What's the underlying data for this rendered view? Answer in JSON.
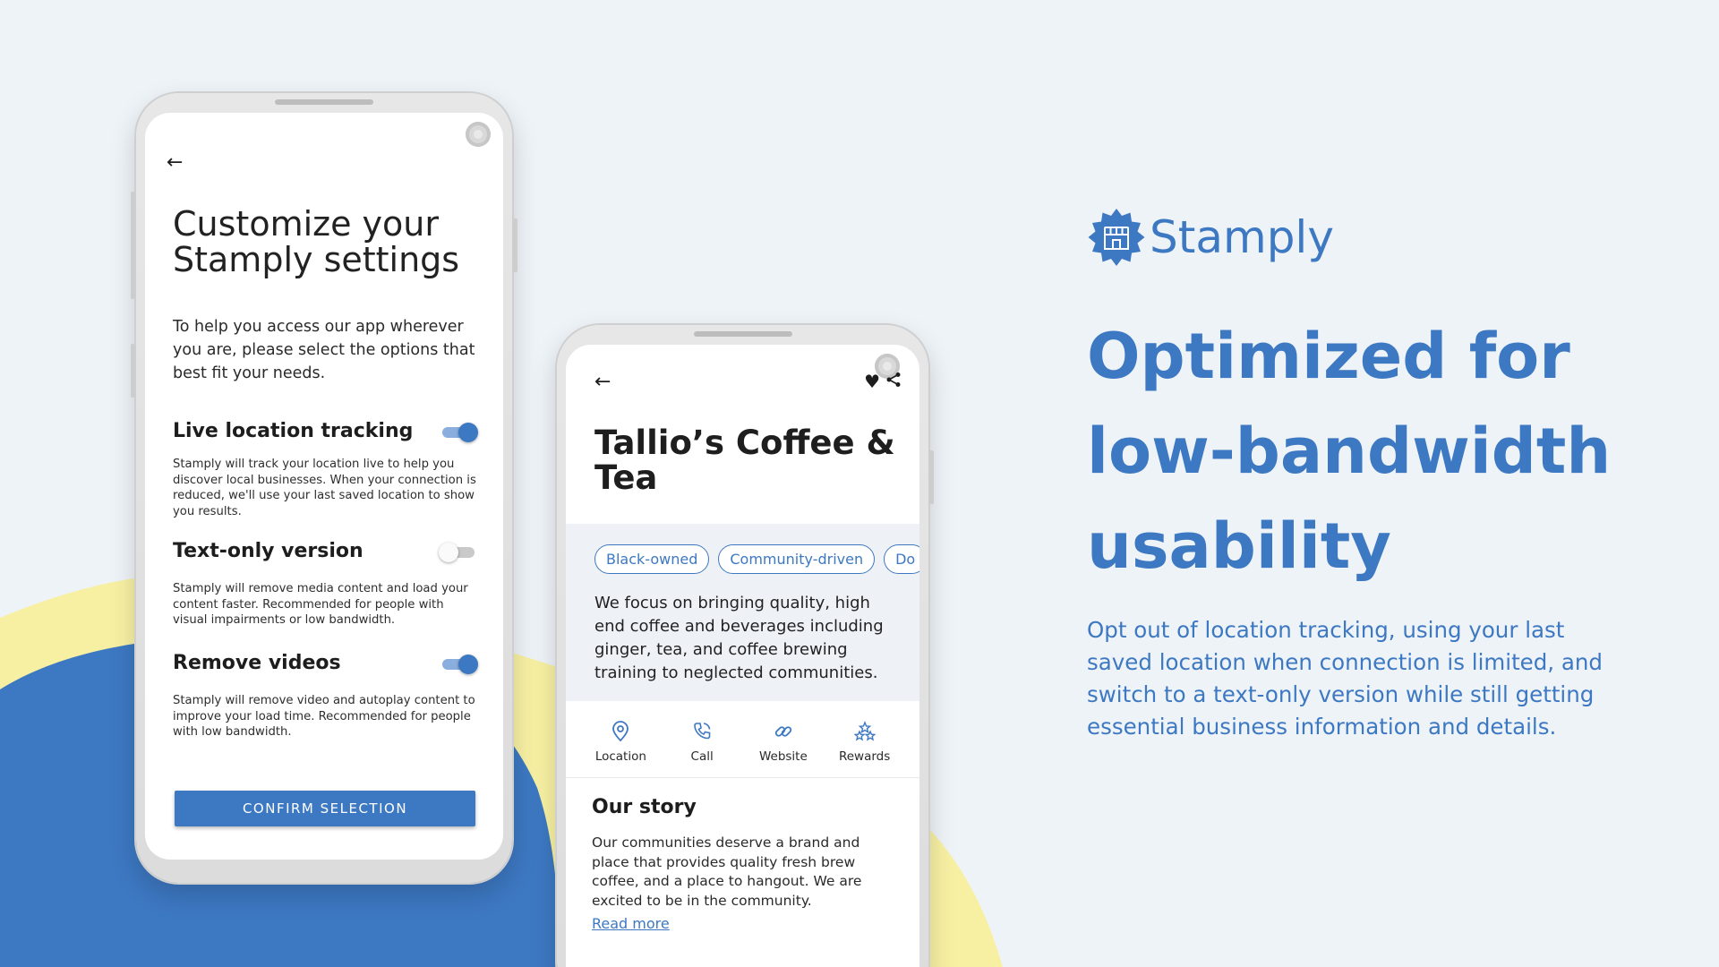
{
  "colors": {
    "accent": "#3d78c2",
    "background": "#eef3f8",
    "yellow_shape": "#f7f0a3",
    "blue_shape": "#3d78c2"
  },
  "phone1": {
    "back_icon": "arrow-left-icon",
    "title": "Customize your Stamply settings",
    "intro": "To help you access our app wherever you are, please select the options that best fit your needs.",
    "options": [
      {
        "heading": "Live location tracking",
        "description": "Stamply will track your location live to help you discover local businesses. When your connection is reduced, we'll use your last saved location to show you results.",
        "enabled": true
      },
      {
        "heading": "Text-only version",
        "description": "Stamply will remove media content and load your content faster. Recommended for people with visual impairments or low bandwidth.",
        "enabled": false
      },
      {
        "heading": "Remove videos",
        "description": "Stamply will remove video and autoplay content to improve your load time. Recommended for people with low bandwidth.",
        "enabled": true
      }
    ],
    "confirm_label": "CONFIRM SELECTION"
  },
  "phone2": {
    "back_icon": "arrow-left-icon",
    "heart_glyph": "♥",
    "share_glyph": "<",
    "title": "Tallio’s Coffee & Tea",
    "tags": [
      "Black-owned",
      "Community-driven",
      "Do"
    ],
    "description": "We focus on bringing quality, high end coffee and beverages including ginger, tea, and coffee brewing training to neglected communities.",
    "nav": [
      {
        "label": "Location",
        "icon": "location-pin-icon",
        "glyph": "⊙"
      },
      {
        "label": "Call",
        "icon": "phone-icon",
        "glyph": "✆"
      },
      {
        "label": "Website",
        "icon": "link-icon",
        "glyph": "∞"
      },
      {
        "label": "Rewards",
        "icon": "rewards-icon",
        "glyph": "⁂"
      }
    ],
    "story_heading": "Our story",
    "story_text": "Our communities deserve a brand and place that provides quality fresh brew coffee, and a place to hangout. We are excited to be in the community.",
    "read_more": "Read more"
  },
  "brand": {
    "name": "Stamply",
    "logo_icon": "storefront-badge-icon"
  },
  "headline": "Optimized for low-bandwidth usability",
  "subtext": "Opt out of location tracking, using your last saved location when connection is limited, and switch to a text-only version while still getting essential business information and details."
}
